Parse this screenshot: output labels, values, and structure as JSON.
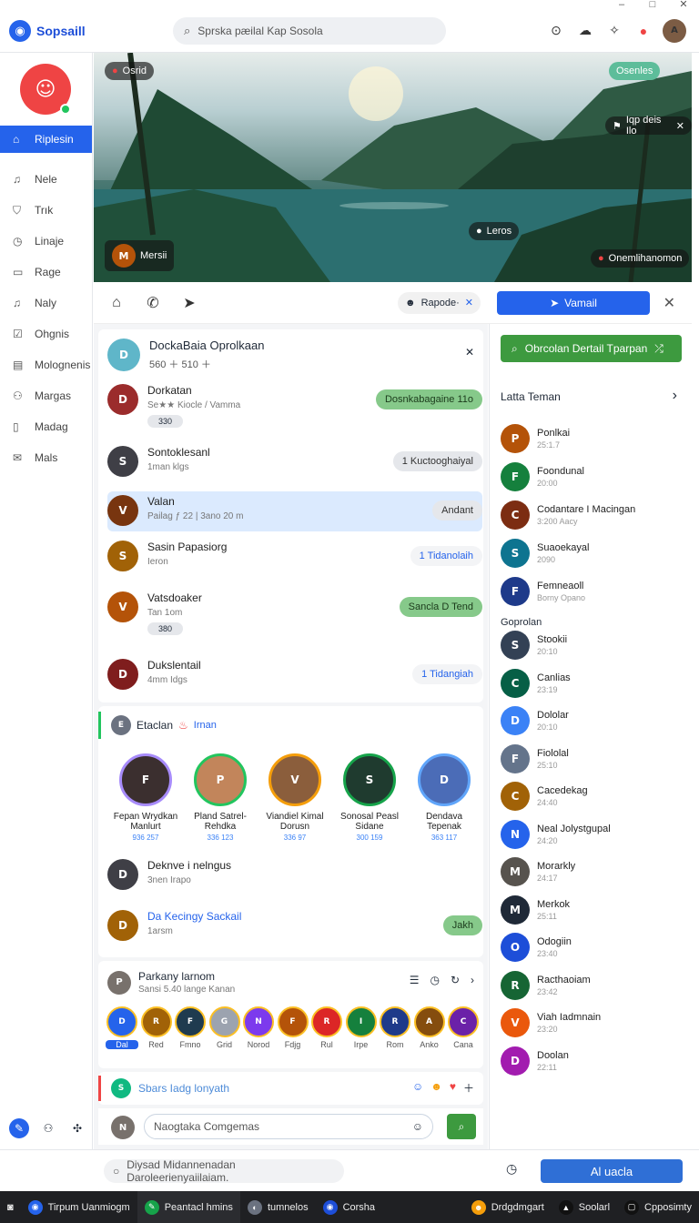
{
  "app": {
    "name": "Sopsaill"
  },
  "search": {
    "placeholder": "Sprska pæilal Kap Sosola"
  },
  "sidebar": {
    "items": [
      {
        "label": "Riplesin",
        "icon": "home-icon"
      },
      {
        "label": "Nele",
        "icon": "bell-icon"
      },
      {
        "label": "Trık",
        "icon": "tag-icon"
      },
      {
        "label": "Linaje",
        "icon": "clock-icon"
      },
      {
        "label": "Rage",
        "icon": "folder-icon"
      },
      {
        "label": "Naly",
        "icon": "bell-icon"
      },
      {
        "label": "Ohgnis",
        "icon": "check-icon"
      },
      {
        "label": "Molognenis",
        "icon": "doc-icon"
      },
      {
        "label": "Margas",
        "icon": "people-icon"
      },
      {
        "label": "Madag",
        "icon": "lock-icon"
      },
      {
        "label": "Mals",
        "icon": "mail-icon"
      }
    ]
  },
  "hero": {
    "live_label": "Osrid",
    "top_right_badge": "Osenles",
    "follow_label": "Iqp deis Ilo",
    "stats_label": "Leros",
    "bottom_left_name": "Mersii",
    "bottom_right_label": "Onemlihanomon"
  },
  "actionbar": {
    "tag_label": "Rapode·",
    "primary_label": "Vamail"
  },
  "group": {
    "title": "DockaBaia Oprolkaan",
    "count_a": "560",
    "count_b": "510"
  },
  "rows": [
    {
      "name": "Dorkatan",
      "sub": "Se★★ Kiocle / Vamma",
      "badge": "330",
      "action": "Dosnkabagaine 11o"
    },
    {
      "name": "Sontoklesanl",
      "sub": "1man klgs",
      "action": "1 Kuctooghaiyal"
    },
    {
      "name": "Valan",
      "sub": "Pailag ƒ 22 | 3ano 20 m",
      "action": "Andant"
    },
    {
      "name": "Sasin Papasiorg",
      "sub": "Ieron",
      "action": "1 Tidanolaih"
    },
    {
      "name": "Vatsdoaker",
      "sub": "Tan 1om",
      "badge": "380",
      "action": "Sancla D Tend"
    },
    {
      "name": "Dukslentail",
      "sub": "4mm Idgs",
      "action": "1 Tidangiah"
    }
  ],
  "people_section": {
    "title": "Etaclan",
    "link": "Irnan"
  },
  "people": [
    {
      "name": "Fepan Wrydkan Manlurt",
      "count": "936 257"
    },
    {
      "name": "Pland Satrel-Rehdka",
      "count": "336 123"
    },
    {
      "name": "Viandiel Kimal Dorusn",
      "count": "336 97"
    },
    {
      "name": "Sonosal Peasl Sidane",
      "count": "300 159"
    },
    {
      "name": "Dendava Tepenak",
      "count": "363 117"
    }
  ],
  "extra_rows": [
    {
      "name": "Deknve i nelngus",
      "sub": "3nen Irapo"
    },
    {
      "name": "Da Kecingy Sackail",
      "sub": "1arsm",
      "action": "Jakh"
    }
  ],
  "stories": {
    "title": "Parkany larnom",
    "sub": "Sansi 5.40 lange Kanan",
    "items": [
      "Dal",
      "Red",
      "Fmno",
      "Grid",
      "Norod",
      "Fdjg",
      "Rul",
      "Irpe",
      "Rom",
      "Anko",
      "Cana"
    ]
  },
  "composer": {
    "reply_label": "Sbars Iadg lonyath",
    "placeholder": "Naogtaka Comgemas"
  },
  "right": {
    "find_label": "Obrcolan Dertail Tparpan",
    "friends_title": "Latta Teman",
    "group_title": "Goprolan",
    "friends": [
      {
        "name": "Ponlkai",
        "sub": "25:1.7"
      },
      {
        "name": "Foondunal",
        "sub": "20:00"
      },
      {
        "name": "Codantare I Macingan",
        "sub": "3:200 Aacy"
      },
      {
        "name": "Suaoekayal",
        "sub": "2090"
      },
      {
        "name": "Femneaoll",
        "sub": "Borny Opano"
      }
    ],
    "groups": [
      {
        "name": "Stookii",
        "sub": "20:10"
      },
      {
        "name": "Canlias",
        "sub": "23:19"
      },
      {
        "name": "Dololar",
        "sub": "20:10"
      },
      {
        "name": "Fiololal",
        "sub": "25:10"
      },
      {
        "name": "Cacedekag",
        "sub": "24:40"
      },
      {
        "name": "Neal Jolystgupal",
        "sub": "24:20"
      },
      {
        "name": "Morarkly",
        "sub": "24:17"
      },
      {
        "name": "Merkok",
        "sub": "25:11"
      },
      {
        "name": "Odogiin",
        "sub": "23:40"
      },
      {
        "name": "Racthaoiam",
        "sub": "23:42"
      },
      {
        "name": "Viah Iadmnain",
        "sub": "23:20"
      },
      {
        "name": "Doolan",
        "sub": "22:11"
      }
    ]
  },
  "footer": {
    "status_text": "Diysad Midannenadan Daroleerienyaiilaiam.",
    "action_label": "Al uacla"
  },
  "taskbar": {
    "items": [
      "Tirpum Uanmiogm",
      "Peantacl hmins",
      "tumnelos",
      "Corsha",
      "Drdgdmgart",
      "Soolarl",
      "Cpposimty"
    ]
  },
  "colors": {
    "primary": "#2563eb",
    "green": "#3d9a3f",
    "green_soft": "#86c98a"
  }
}
